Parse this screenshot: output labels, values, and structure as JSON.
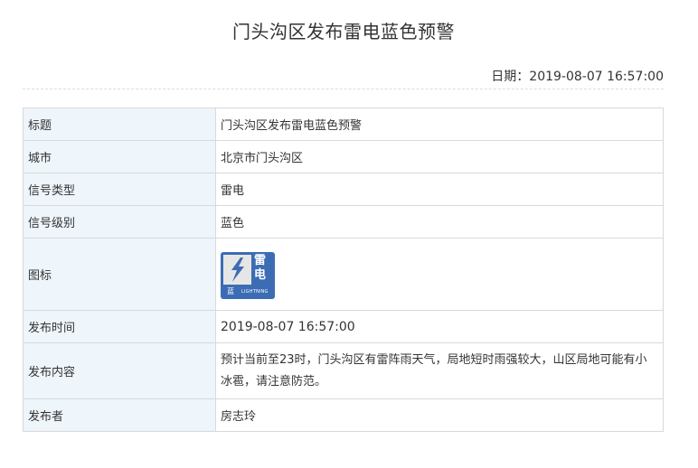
{
  "header": {
    "title": "门头沟区发布雷电蓝色预警",
    "date_label": "日期：",
    "date_value": "2019-08-07 16:57:00"
  },
  "table": {
    "rows": [
      {
        "key": "标题",
        "value": "门头沟区发布雷电蓝色预警"
      },
      {
        "key": "城市",
        "value": "北京市门头沟区"
      },
      {
        "key": "信号类型",
        "value": "雷电"
      },
      {
        "key": "信号级别",
        "value": "蓝色"
      },
      {
        "key": "图标"
      },
      {
        "key": "发布时间",
        "value": "2019-08-07 16:57:00"
      },
      {
        "key": "发布内容",
        "value": "预计当前至23时，门头沟区有雷阵雨天气，局地短时雨强较大，山区局地可能有小冰雹，请注意防范。"
      },
      {
        "key": "发布者",
        "value": "房志玲"
      }
    ]
  },
  "icon": {
    "name": "lightning-warning-icon",
    "char_top": "雷",
    "char_bottom": "电",
    "foot_cn": "蓝",
    "foot_en": "LIGHTNING",
    "color": "#3c6cb4"
  }
}
